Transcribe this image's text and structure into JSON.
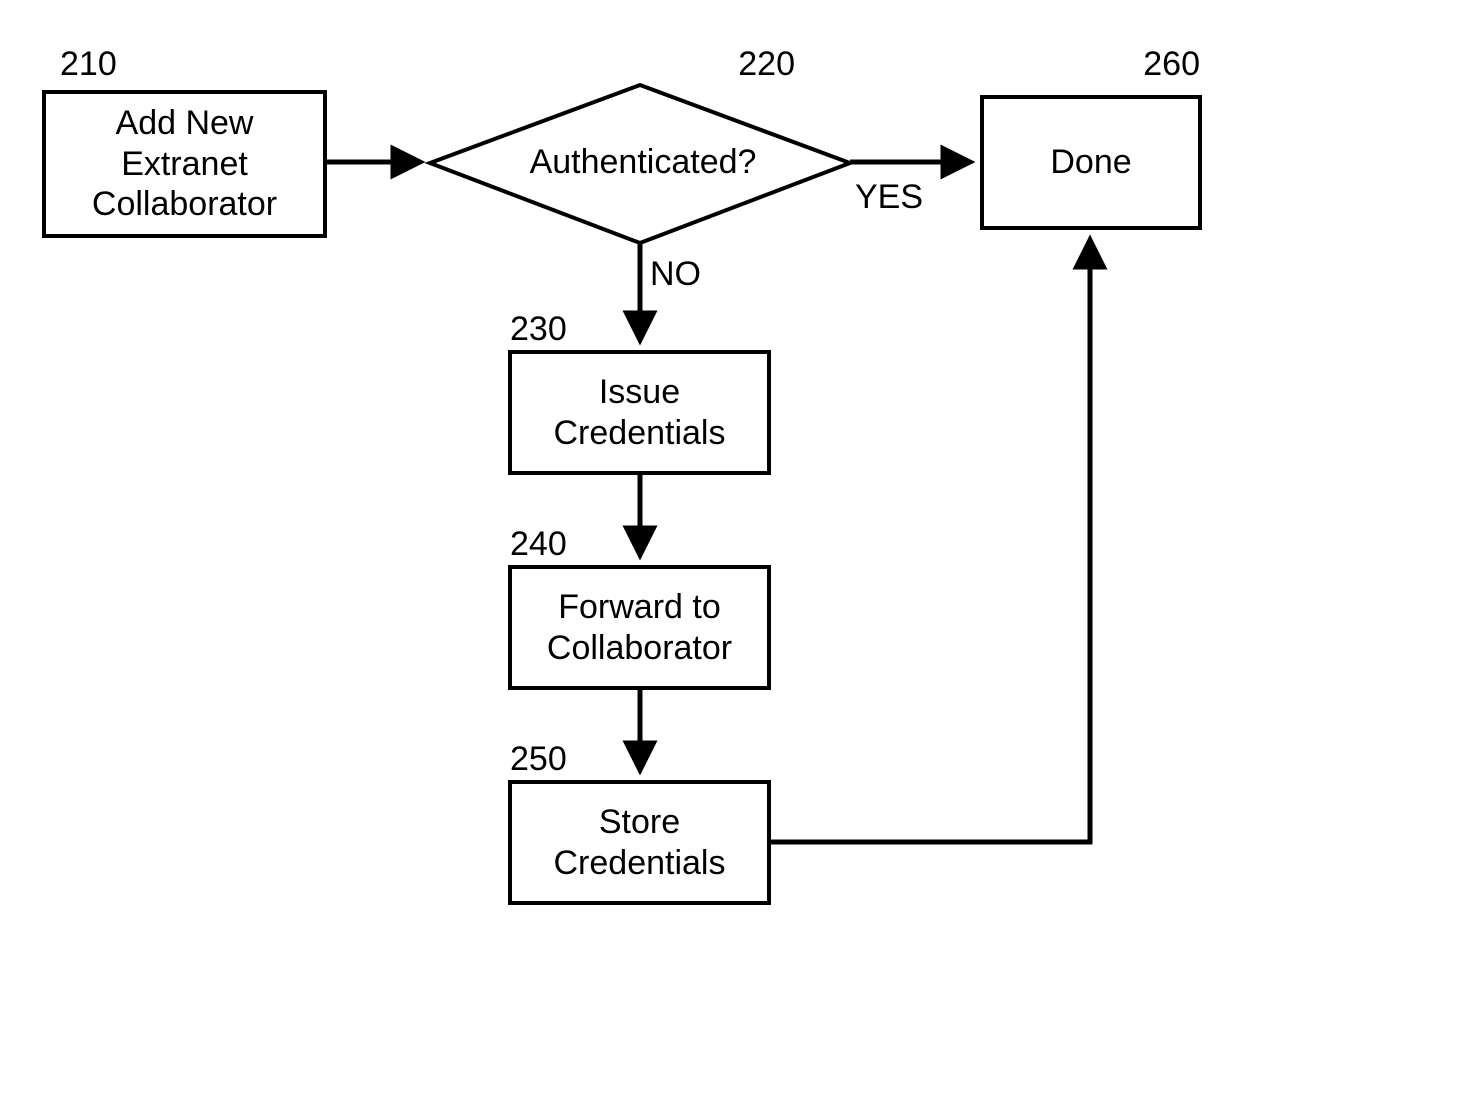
{
  "nodes": {
    "n210": {
      "num": "210",
      "label": "Add New\nExtranet\nCollaborator"
    },
    "n220": {
      "num": "220",
      "label": "Authenticated?"
    },
    "n230": {
      "num": "230",
      "label": "Issue\nCredentials"
    },
    "n240": {
      "num": "240",
      "label": "Forward to\nCollaborator"
    },
    "n250": {
      "num": "250",
      "label": "Store\nCredentials"
    },
    "n260": {
      "num": "260",
      "label": "Done"
    }
  },
  "edges": {
    "yes": "YES",
    "no": "NO"
  }
}
